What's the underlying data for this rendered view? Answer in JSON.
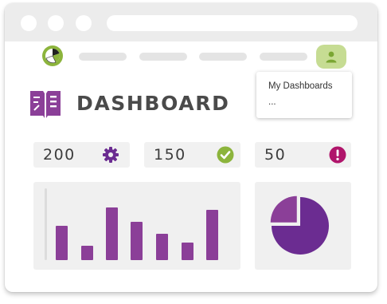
{
  "header": {
    "user_menu": {
      "items": [
        "My Dashboards",
        "..."
      ]
    }
  },
  "page": {
    "title": "DASHBOARD"
  },
  "stats": [
    {
      "value": "200",
      "icon": "gear-icon",
      "color": "#6b2c91"
    },
    {
      "value": "150",
      "icon": "check-circle-icon",
      "color": "#8cb43c"
    },
    {
      "value": "50",
      "icon": "alert-circle-icon",
      "color": "#b0156b"
    }
  ],
  "chart_data": [
    {
      "type": "bar",
      "values": [
        43,
        18,
        66,
        48,
        33,
        22,
        63
      ],
      "ylim": [
        0,
        100
      ],
      "color": "#8b3f98"
    },
    {
      "type": "pie",
      "values": [
        75,
        25
      ],
      "colors": [
        "#6b2c91",
        "#8b3f98"
      ]
    }
  ],
  "colors": {
    "accent": "#8b3f98",
    "accent_dark": "#6b2c91",
    "success": "#8cb43c",
    "danger": "#b0156b",
    "user_button": "#c6dc93"
  }
}
